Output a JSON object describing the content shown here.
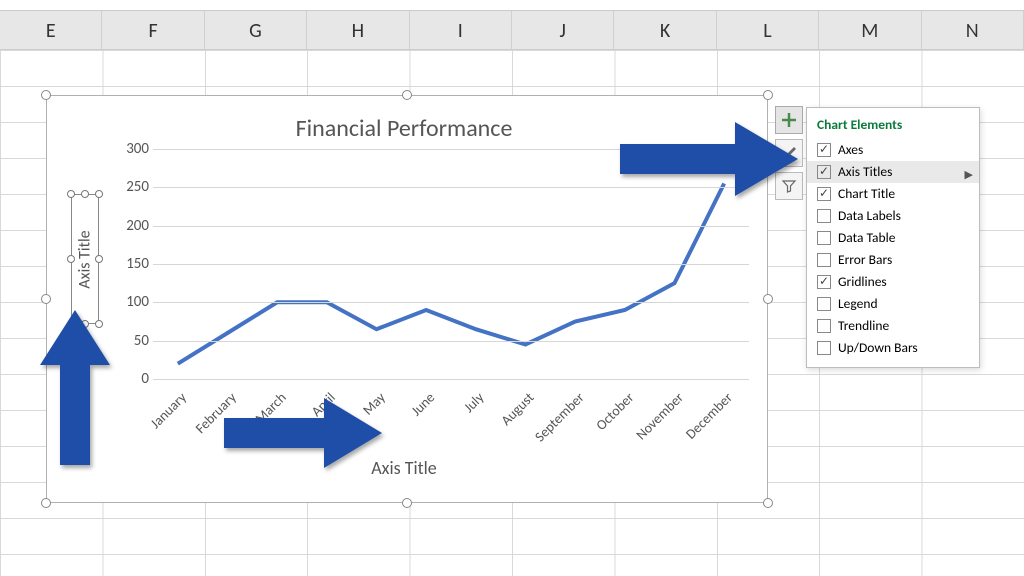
{
  "columns": [
    "E",
    "F",
    "G",
    "H",
    "I",
    "J",
    "K",
    "L",
    "M",
    "N"
  ],
  "chart": {
    "title": "Financial Performance",
    "y_axis_title": "Axis Title",
    "x_axis_title": "Axis Title"
  },
  "chart_data": {
    "type": "line",
    "title": "Financial Performance",
    "xlabel": "Axis Title",
    "ylabel": "Axis Title",
    "ylim": [
      0,
      300
    ],
    "y_ticks": [
      0,
      50,
      100,
      150,
      200,
      250,
      300
    ],
    "categories": [
      "January",
      "February",
      "March",
      "April",
      "May",
      "June",
      "July",
      "August",
      "September",
      "October",
      "November",
      "December"
    ],
    "values": [
      20,
      60,
      100,
      100,
      65,
      90,
      65,
      45,
      75,
      90,
      125,
      255
    ]
  },
  "chart_buttons": {
    "plus_tooltip": "Chart Elements",
    "brush_tooltip": "Chart Styles",
    "filter_tooltip": "Chart Filters"
  },
  "flyout": {
    "title": "Chart Elements",
    "items": [
      {
        "label": "Axes",
        "checked": true,
        "highlight": false
      },
      {
        "label": "Axis Titles",
        "checked": true,
        "highlight": true,
        "submenu": true
      },
      {
        "label": "Chart Title",
        "checked": true,
        "highlight": false
      },
      {
        "label": "Data Labels",
        "checked": false,
        "highlight": false
      },
      {
        "label": "Data Table",
        "checked": false,
        "highlight": false
      },
      {
        "label": "Error Bars",
        "checked": false,
        "highlight": false
      },
      {
        "label": "Gridlines",
        "checked": true,
        "highlight": false
      },
      {
        "label": "Legend",
        "checked": false,
        "highlight": false
      },
      {
        "label": "Trendline",
        "checked": false,
        "highlight": false
      },
      {
        "label": "Up/Down Bars",
        "checked": false,
        "highlight": false
      }
    ]
  }
}
